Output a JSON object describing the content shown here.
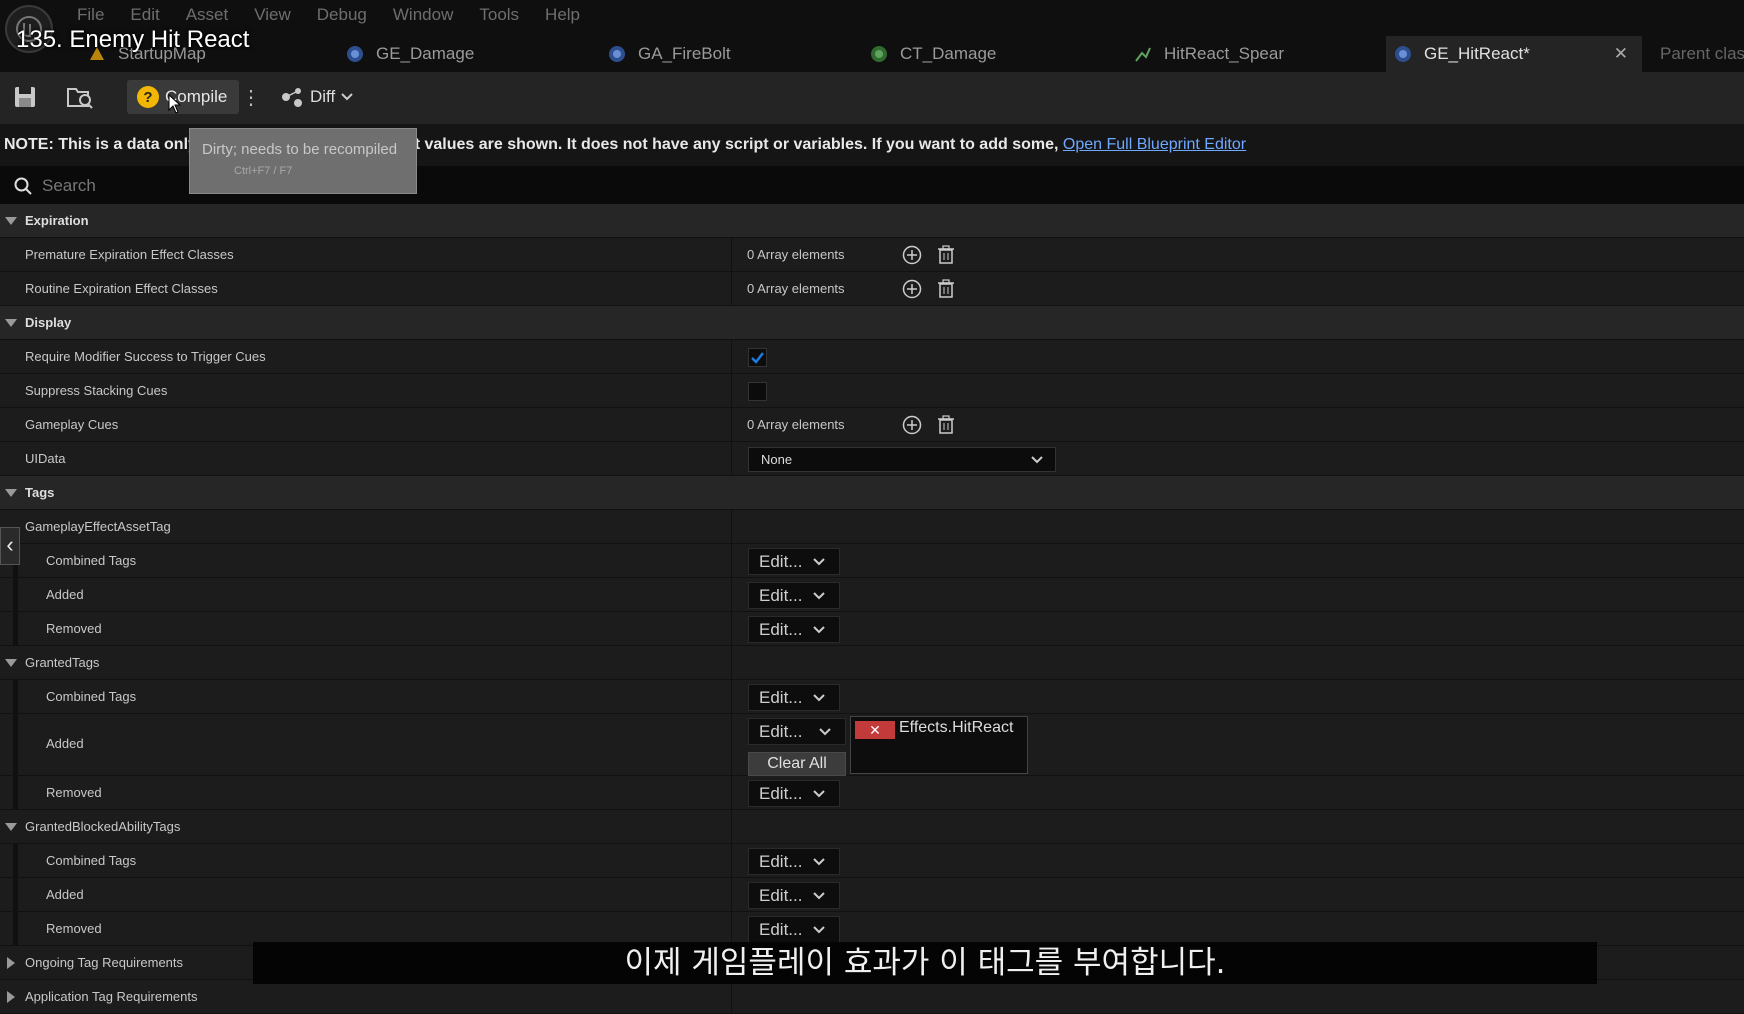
{
  "overlay_title": "135. Enemy Hit React",
  "menu": [
    "File",
    "Edit",
    "Asset",
    "View",
    "Debug",
    "Window",
    "Tools",
    "Help"
  ],
  "tabs": [
    {
      "label": "StartupMap",
      "icon": "level-icon"
    },
    {
      "label": "GE_Damage",
      "icon": "gameplay-effect-icon"
    },
    {
      "label": "GA_FireBolt",
      "icon": "gameplay-ability-icon"
    },
    {
      "label": "CT_Damage",
      "icon": "curve-table-icon"
    },
    {
      "label": "HitReact_Spear",
      "icon": "animation-icon"
    },
    {
      "label": "GE_HitReact*",
      "icon": "gameplay-effect-icon",
      "active": true
    },
    {
      "label": "Parent clas",
      "icon": ""
    }
  ],
  "toolbar": {
    "compile_label": "Compile",
    "diff_label": "Diff",
    "tooltip_title": "Dirty; needs to be recompiled",
    "tooltip_hint": "Ctrl+F7 / F7"
  },
  "note": {
    "text": "NOTE: This is a data only blueprint, so only the default values are shown.  It does not have any script or variables.  If you want to add some, ",
    "link": "Open Full Blueprint Editor"
  },
  "search": {
    "placeholder": "Search"
  },
  "categories": {
    "expiration": "Expiration",
    "display": "Display",
    "tags": "Tags",
    "ongoing": "Ongoing Tag Requirements",
    "application": "Application Tag Requirements"
  },
  "properties": {
    "premature": "Premature Expiration Effect Classes",
    "routine": "Routine Expiration Effect Classes",
    "require_modifier": "Require Modifier Success to Trigger Cues",
    "suppress_stacking": "Suppress Stacking Cues",
    "gameplay_cues": "Gameplay Cues",
    "uidata": "UIData",
    "asset_tag": "GameplayEffectAssetTag",
    "granted_tags": "GrantedTags",
    "granted_blocked": "GrantedBlockedAbilityTags",
    "combined": "Combined Tags",
    "added": "Added",
    "removed": "Removed"
  },
  "values": {
    "array_elements": "0 Array elements",
    "uidata_value": "None",
    "edit_label": "Edit...",
    "clear_all": "Clear All",
    "added_tag": "Effects.HitReact",
    "require_modifier_checked": true,
    "suppress_stacking_checked": false
  },
  "subtitle": "이제 게임플레이 효과가 이 태그를 부여합니다.",
  "colors": {
    "accent": "#1f7ae0",
    "tag_remove": "#c23a3a",
    "warning": "#f2b705",
    "link": "#6fa8ff"
  }
}
